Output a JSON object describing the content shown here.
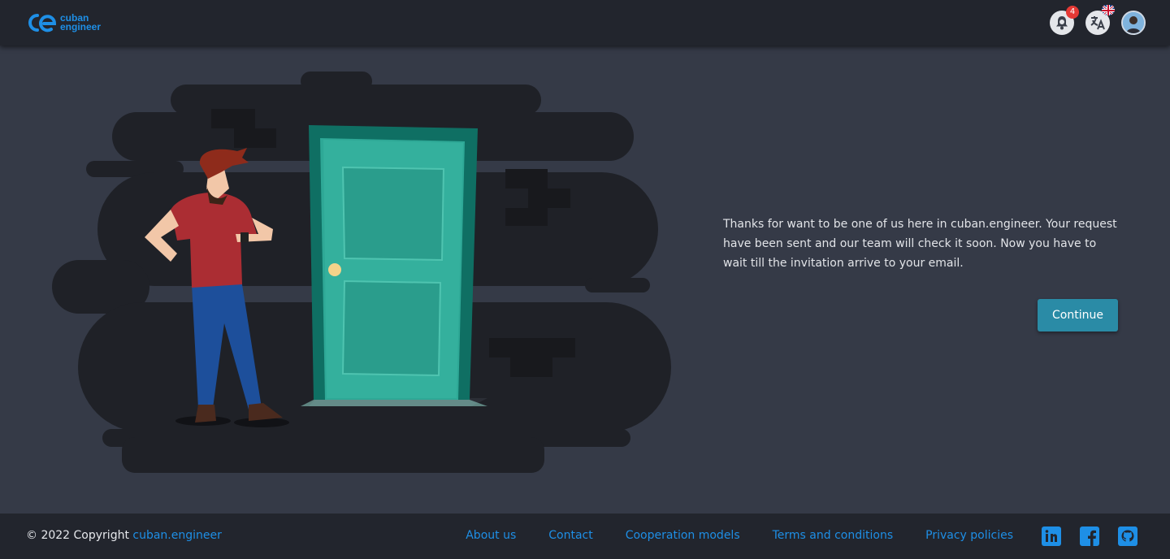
{
  "header": {
    "logo_line1": "cuban",
    "logo_line2": "engineer",
    "notifications_count": "4",
    "icons": [
      "notification-bell-icon",
      "translate-icon",
      "uk-flag-icon",
      "user-avatar"
    ]
  },
  "main": {
    "message": "Thanks for want to be one of us here in cuban.engineer. Your request have been sent and our team will check it soon. Now you have to wait till the invitation arrive to your email.",
    "continue_label": "Continue"
  },
  "footer": {
    "copyright_prefix": "© 2022 Copyright ",
    "copyright_link": "cuban.engineer",
    "links": [
      "About us",
      "Contact",
      "Cooperation models",
      "Terms and conditions",
      "Privacy policies"
    ],
    "socials": [
      "linkedin-icon",
      "facebook-icon",
      "github-icon"
    ]
  },
  "colors": {
    "accent": "#1e8fe6",
    "button": "#2a8ba6",
    "background": "#353a47",
    "bar": "#22252d",
    "badge": "#e53935"
  }
}
